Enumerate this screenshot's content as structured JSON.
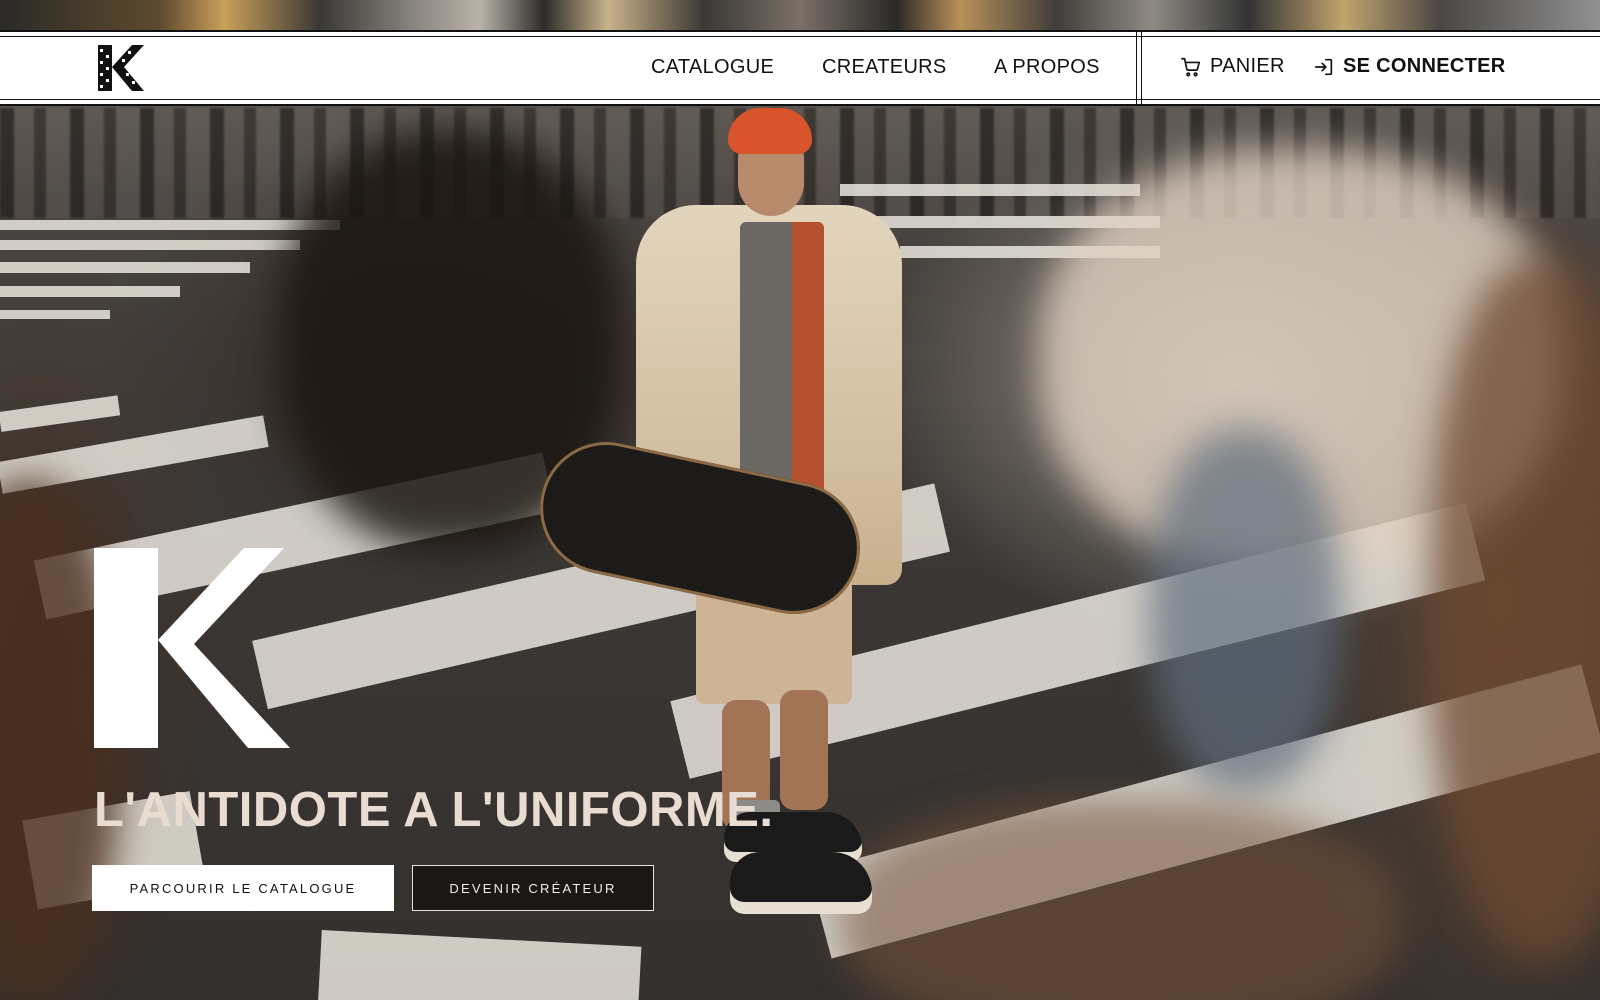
{
  "header": {
    "logo_alt": "K",
    "nav": {
      "catalogue": "CATALOGUE",
      "createurs": "CREATEURS",
      "apropos": "A PROPOS",
      "panier": "PANIER",
      "connect": "SE CONNECTER"
    },
    "icons": {
      "cart": "cart-icon",
      "login": "login-icon"
    }
  },
  "hero": {
    "title": "L'ANTIDOTE A L'UNIFORME.",
    "primary_button": "PARCOURIR LE CATALOGUE",
    "secondary_button": "DEVENIR CRÉATEUR"
  },
  "colors": {
    "header_bg": "#ffffff",
    "text_dark": "#111111",
    "hero_title": "#e8ddd0",
    "button_primary_bg": "#ffffff",
    "button_secondary_bg": "#141210"
  }
}
